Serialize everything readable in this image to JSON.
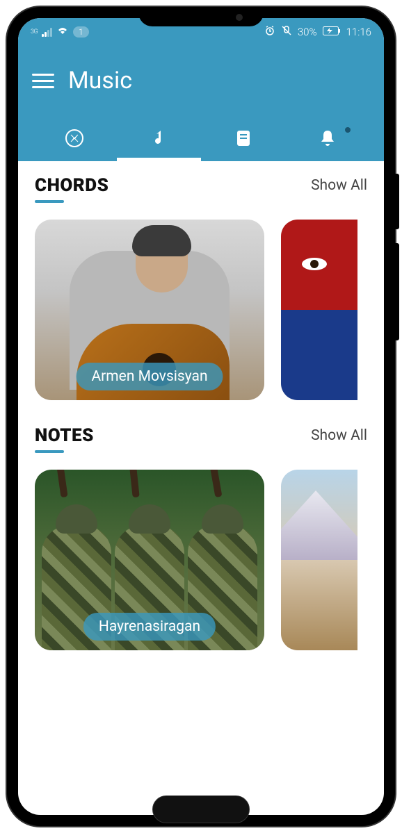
{
  "status_bar": {
    "network_label": "3G",
    "badge_count": "1",
    "battery_text": "30%",
    "time": "11:16"
  },
  "header": {
    "title": "Music"
  },
  "sections": {
    "chords": {
      "title": "CHORDS",
      "show_all": "Show All",
      "card_label": "Armen Movsisyan"
    },
    "notes": {
      "title": "NOTES",
      "show_all": "Show All",
      "card_label": "Hayrenasiragan"
    }
  }
}
